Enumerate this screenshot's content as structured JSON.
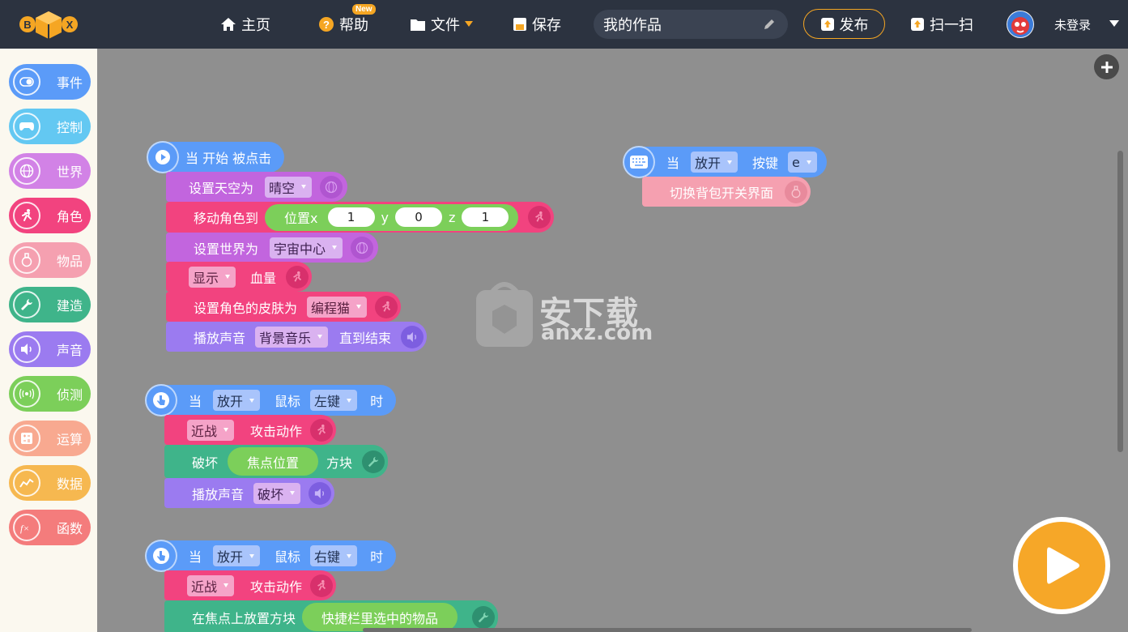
{
  "header": {
    "logo_text": "BOX",
    "nav": {
      "home": "主页",
      "help": "帮助",
      "help_badge": "New",
      "file": "文件",
      "save": "保存",
      "publish": "发布",
      "scan": "扫一扫"
    },
    "project_title": "我的作品",
    "login": "未登录"
  },
  "sidebar": {
    "items": [
      {
        "label": "事件",
        "color": "#5b9bf8",
        "icon": "toggle-icon"
      },
      {
        "label": "控制",
        "color": "#63c8f2",
        "icon": "gamepad-icon"
      },
      {
        "label": "世界",
        "color": "#d282e6",
        "icon": "globe-icon"
      },
      {
        "label": "角色",
        "color": "#f2437f",
        "icon": "running-icon"
      },
      {
        "label": "物品",
        "color": "#f5a0b0",
        "icon": "potion-icon"
      },
      {
        "label": "建造",
        "color": "#3fb48a",
        "icon": "wrench-icon"
      },
      {
        "label": "声音",
        "color": "#9b7bf0",
        "icon": "speaker-icon"
      },
      {
        "label": "侦测",
        "color": "#7ccf5a",
        "icon": "sensor-icon"
      },
      {
        "label": "运算",
        "color": "#f8a990",
        "icon": "calculator-icon"
      },
      {
        "label": "数据",
        "color": "#f6b850",
        "icon": "chart-icon"
      },
      {
        "label": "函数",
        "color": "#f47c7c",
        "icon": "function-icon"
      }
    ]
  },
  "scripts": {
    "s1": {
      "hat": "当 开始 被点击",
      "sky_label": "设置天空为",
      "sky_value": "晴空",
      "move_label": "移动角色到",
      "pos_label": "位置x",
      "x": "1",
      "y_label": "y",
      "y": "0",
      "z_label": "z",
      "z": "1",
      "world_label": "设置世界为",
      "world_value": "宇宙中心",
      "show_value": "显示",
      "health_label": "血量",
      "skin_label": "设置角色的皮肤为",
      "skin_value": "编程猫",
      "play_label": "播放声音",
      "play_value": "背景音乐",
      "until_label": "直到结束"
    },
    "s2": {
      "when": "当",
      "action": "放开",
      "mouse": "鼠标",
      "button": "左键",
      "time": "时",
      "melee": "近战",
      "attack": "攻击动作",
      "break_label": "破坏",
      "focus": "焦点位置",
      "block": "方块",
      "play_label": "播放声音",
      "play_value": "破坏"
    },
    "s3": {
      "when": "当",
      "action": "放开",
      "mouse": "鼠标",
      "button": "右键",
      "time": "时",
      "melee": "近战",
      "attack": "攻击动作",
      "place_label": "在焦点上放置方块",
      "place_value": "快捷栏里选中的物品"
    },
    "s4": {
      "when": "当",
      "action": "放开",
      "key_label": "按键",
      "key": "e",
      "toggle": "切换背包开关界面"
    }
  },
  "watermark": {
    "text": "安下载",
    "url": "anxz.com"
  }
}
